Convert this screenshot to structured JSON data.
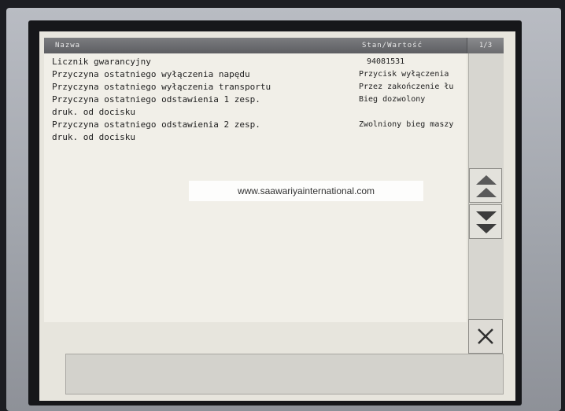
{
  "header": {
    "name_col": "Nazwa",
    "state_col": "Stan/Wartość",
    "page_indicator": "1/3"
  },
  "rows": [
    {
      "name": "Licznik gwarancyjny",
      "value": "94081531"
    },
    {
      "name": "Przyczyna ostatniego wyłączenia napędu",
      "value": "Przycisk wyłączenia"
    },
    {
      "name": "Przyczyna ostatniego wyłączenia transportu",
      "value": "Przez zakończenie łu"
    },
    {
      "name": "Przyczyna ostatniego odstawienia 1 zesp.",
      "value": "Bieg dozwolony"
    },
    {
      "name": " druk. od docisku",
      "value": ""
    },
    {
      "name": "Przyczyna ostatniego odstawienia 2 zesp.",
      "value": "Zwolniony bieg maszy"
    },
    {
      "name": " druk. od docisku",
      "value": ""
    }
  ],
  "watermark": "www.saawariyainternational.com",
  "icons": {
    "scroll_up": "double-chevron-up-icon",
    "scroll_down": "double-chevron-down-icon",
    "close": "close-icon"
  },
  "colors": {
    "header_bg": "#6b6c70",
    "list_bg": "#f1efe8",
    "screen_bg": "#e7e5dd"
  }
}
